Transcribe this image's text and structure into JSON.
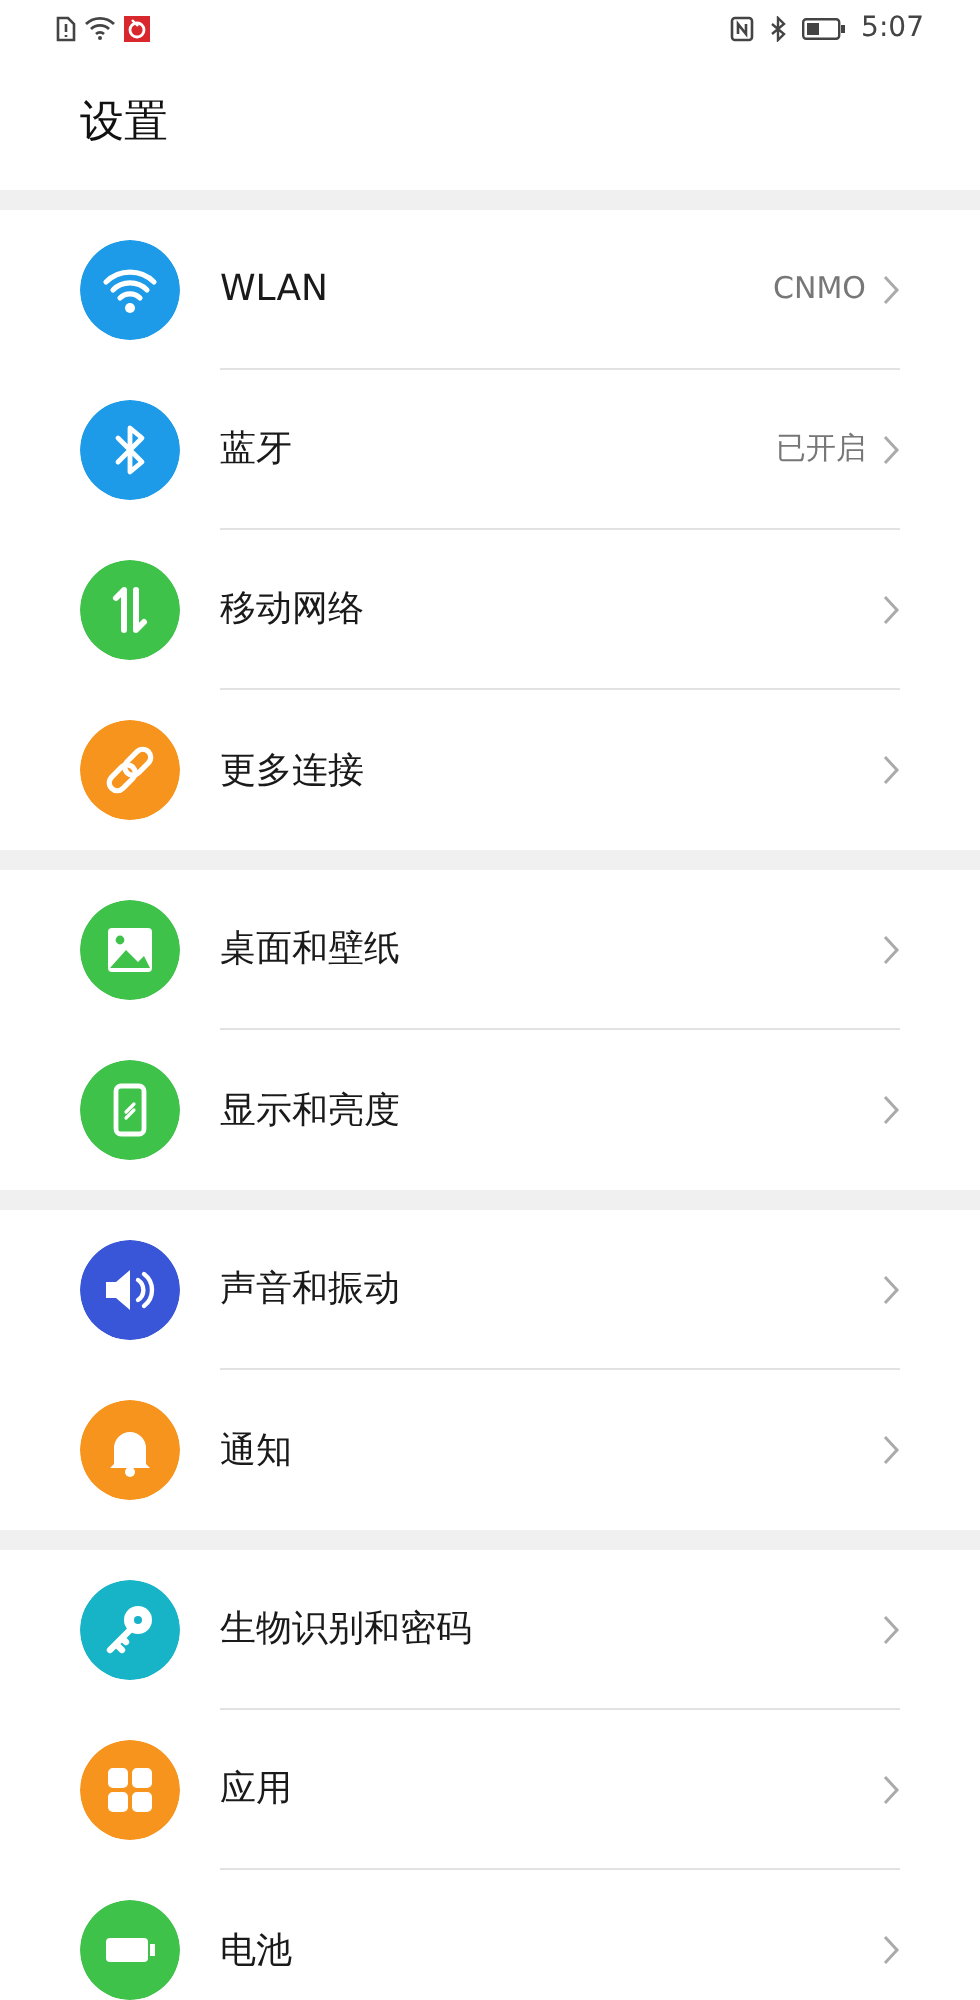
{
  "status_bar": {
    "time": "5:07"
  },
  "title": "设置",
  "groups": [
    {
      "items": [
        {
          "label": "WLAN",
          "value": "CNMO",
          "kind": "wifi",
          "color": "#1e9be8"
        },
        {
          "label": "蓝牙",
          "value": "已开启",
          "kind": "bluetooth",
          "color": "#1e9be8"
        },
        {
          "label": "移动网络",
          "kind": "data",
          "color": "#3ec24a"
        },
        {
          "label": "更多连接",
          "kind": "link",
          "color": "#f7941d"
        }
      ]
    },
    {
      "items": [
        {
          "label": "桌面和壁纸",
          "kind": "image",
          "color": "#3ec24a"
        },
        {
          "label": "显示和亮度",
          "kind": "phone",
          "color": "#3ec24a"
        }
      ]
    },
    {
      "items": [
        {
          "label": "声音和振动",
          "kind": "sound",
          "color": "#3a56d8"
        },
        {
          "label": "通知",
          "kind": "bell",
          "color": "#f7941d"
        }
      ]
    },
    {
      "items": [
        {
          "label": "生物识别和密码",
          "kind": "key",
          "color": "#17b3c6"
        },
        {
          "label": "应用",
          "kind": "apps",
          "color": "#f7941d"
        },
        {
          "label": "电池",
          "kind": "battery",
          "color": "#3ec24a"
        }
      ]
    }
  ]
}
